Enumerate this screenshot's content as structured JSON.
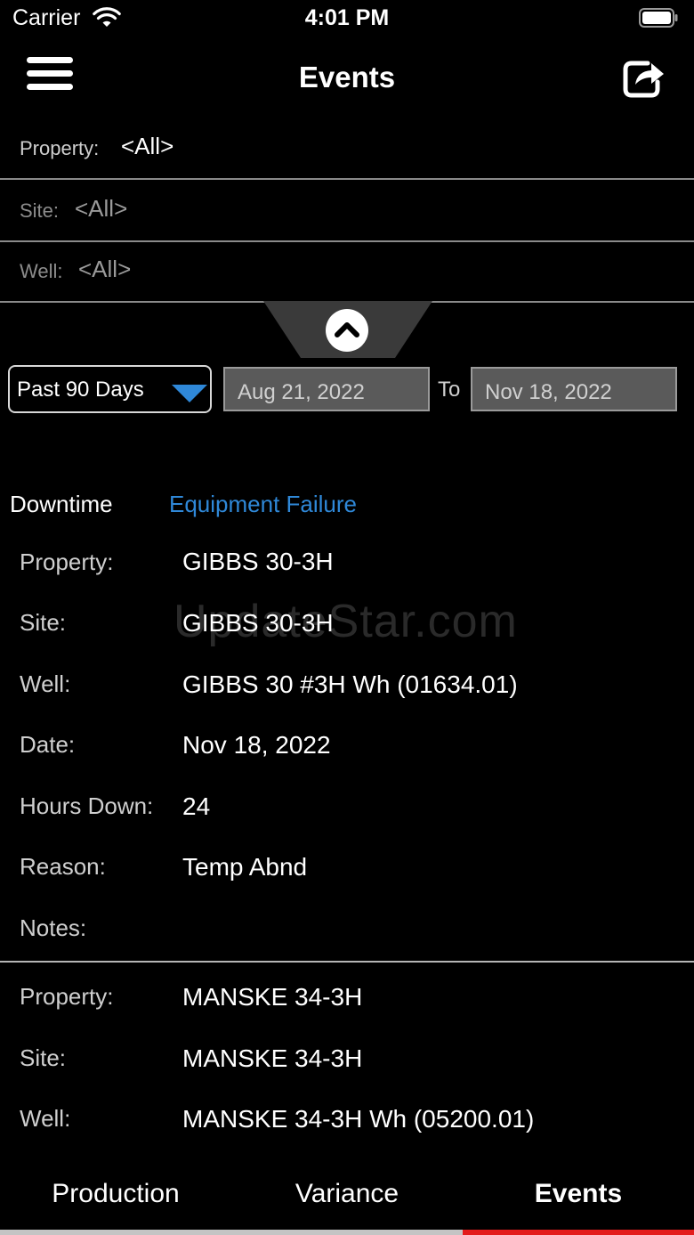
{
  "status_bar": {
    "carrier": "Carrier",
    "time": "4:01 PM"
  },
  "nav": {
    "title": "Events",
    "menu_icon": "hamburger-menu-icon",
    "share_icon": "share-icon"
  },
  "filters": {
    "property_label": "Property:",
    "property_value": "<All>",
    "site_label": "Site:",
    "site_value": "<All>",
    "well_label": "Well:",
    "well_value": "<All>"
  },
  "date_range": {
    "preset": "Past 90 Days",
    "from": "Aug 21, 2022",
    "to_label": "To",
    "to": "Nov 18, 2022"
  },
  "events": [
    {
      "type": "Downtime",
      "category": "Equipment Failure",
      "fields": [
        {
          "label": "Property:",
          "value": "GIBBS 30-3H"
        },
        {
          "label": "Site:",
          "value": "GIBBS 30-3H"
        },
        {
          "label": "Well:",
          "value": "GIBBS 30 #3H Wh (01634.01)"
        },
        {
          "label": "Date:",
          "value": "Nov 18, 2022"
        },
        {
          "label": "Hours Down:",
          "value": "24"
        },
        {
          "label": "Reason:",
          "value": "Temp Abnd"
        },
        {
          "label": "Notes:",
          "value": ""
        }
      ]
    },
    {
      "fields": [
        {
          "label": "Property:",
          "value": "MANSKE 34-3H"
        },
        {
          "label": "Site:",
          "value": "MANSKE 34-3H"
        },
        {
          "label": "Well:",
          "value": "MANSKE 34-3H Wh (05200.01)"
        }
      ]
    }
  ],
  "watermark": "UpdateStar.com",
  "tabs": [
    "Production",
    "Variance",
    "Events"
  ],
  "active_tab": "Events",
  "colors": {
    "background": "#000000",
    "link": "#2f88d8",
    "tab_indicator": "#e31b1b"
  }
}
